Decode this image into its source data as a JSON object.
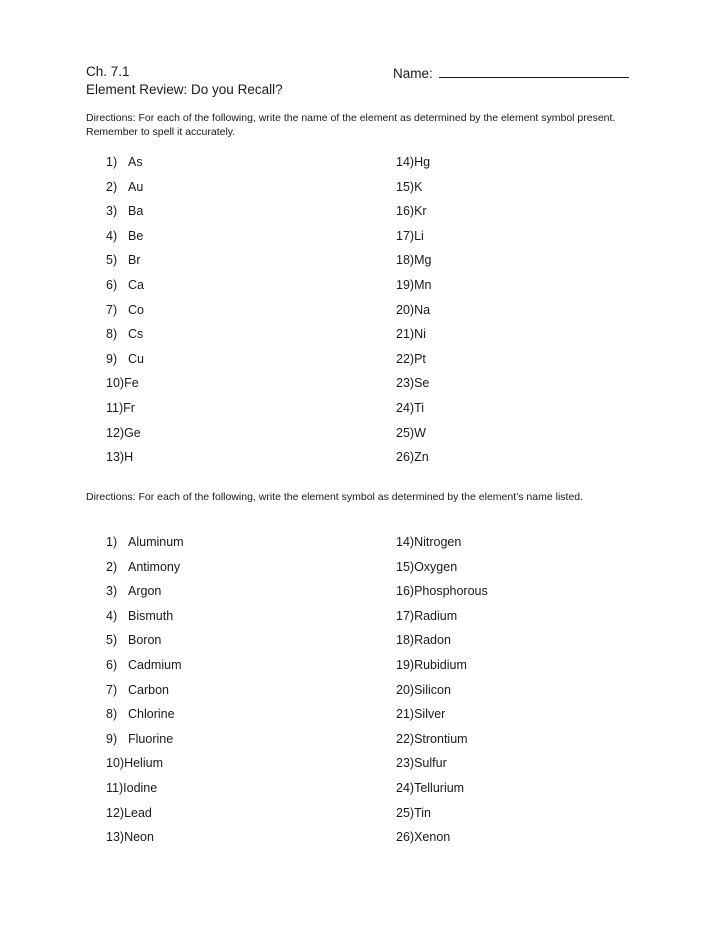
{
  "header": {
    "chapter": "Ch. 7.1",
    "title": "Element Review:  Do you Recall?",
    "name_label": "Name:"
  },
  "section1": {
    "directions": "Directions:  For each of the following, write the name of the element as determined by the element symbol present.  Remember to spell it accurately.",
    "left": [
      {
        "num": "1)",
        "text": "As"
      },
      {
        "num": "2)",
        "text": "Au"
      },
      {
        "num": "3)",
        "text": "Ba"
      },
      {
        "num": "4)",
        "text": "Be"
      },
      {
        "num": "5)",
        "text": "Br"
      },
      {
        "num": "6)",
        "text": "Ca"
      },
      {
        "num": "7)",
        "text": "Co"
      },
      {
        "num": "8)",
        "text": "Cs"
      },
      {
        "num": "9)",
        "text": "Cu"
      },
      {
        "num": "10)",
        "text": "Fe"
      },
      {
        "num": "11)",
        "text": "Fr"
      },
      {
        "num": "12)",
        "text": "Ge"
      },
      {
        "num": "13)",
        "text": "H"
      }
    ],
    "right": [
      {
        "num": "14)",
        "text": "Hg"
      },
      {
        "num": "15)",
        "text": "K"
      },
      {
        "num": "16)",
        "text": "Kr"
      },
      {
        "num": "17)",
        "text": "Li"
      },
      {
        "num": "18)",
        "text": "Mg"
      },
      {
        "num": "19)",
        "text": "Mn"
      },
      {
        "num": "20)",
        "text": "Na"
      },
      {
        "num": "21)",
        "text": "Ni"
      },
      {
        "num": "22)",
        "text": "Pt"
      },
      {
        "num": "23)",
        "text": "Se"
      },
      {
        "num": "24)",
        "text": "Ti"
      },
      {
        "num": "25)",
        "text": "W"
      },
      {
        "num": "26)",
        "text": "Zn"
      }
    ]
  },
  "section2": {
    "directions": "Directions:  For each of the following, write the element symbol as determined by the element’s name listed.",
    "left": [
      {
        "num": "1)",
        "text": "Aluminum"
      },
      {
        "num": "2)",
        "text": "Antimony"
      },
      {
        "num": "3)",
        "text": "Argon"
      },
      {
        "num": "4)",
        "text": "Bismuth"
      },
      {
        "num": "5)",
        "text": "Boron"
      },
      {
        "num": "6)",
        "text": "Cadmium"
      },
      {
        "num": "7)",
        "text": "Carbon"
      },
      {
        "num": "8)",
        "text": "Chlorine"
      },
      {
        "num": "9)",
        "text": "Fluorine"
      },
      {
        "num": "10)",
        "text": "Helium"
      },
      {
        "num": "11)",
        "text": "Iodine"
      },
      {
        "num": "12)",
        "text": "Lead"
      },
      {
        "num": "13)",
        "text": "Neon"
      }
    ],
    "right": [
      {
        "num": "14)",
        "text": "Nitrogen"
      },
      {
        "num": "15)",
        "text": "Oxygen"
      },
      {
        "num": "16)",
        "text": "Phosphorous"
      },
      {
        "num": "17)",
        "text": "Radium"
      },
      {
        "num": "18)",
        "text": "Radon"
      },
      {
        "num": "19)",
        "text": "Rubidium"
      },
      {
        "num": "20)",
        "text": "Silicon"
      },
      {
        "num": "21)",
        "text": "Silver"
      },
      {
        "num": "22)",
        "text": "Strontium"
      },
      {
        "num": "23)",
        "text": "Sulfur"
      },
      {
        "num": "24)",
        "text": "Tellurium"
      },
      {
        "num": "25)",
        "text": "Tin"
      },
      {
        "num": "26)",
        "text": "Xenon"
      }
    ]
  }
}
